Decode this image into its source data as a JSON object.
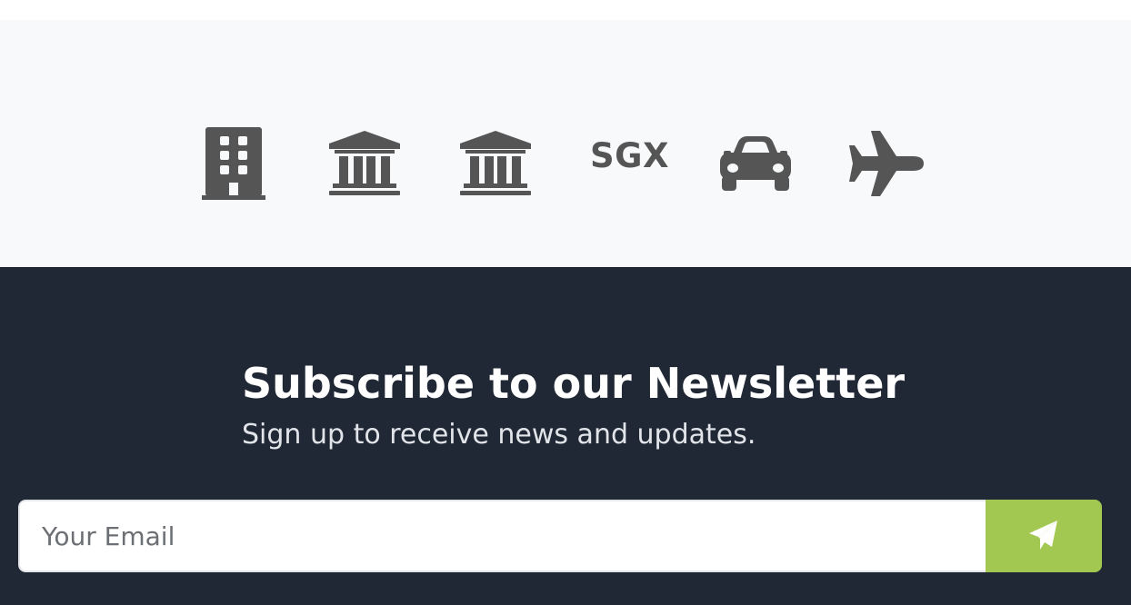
{
  "logos": {
    "icons": [
      "building-icon",
      "bank-icon",
      "bank-icon",
      "car-icon",
      "plane-icon"
    ],
    "sgx_text": "SGX",
    "icon_color": "#555555"
  },
  "newsletter": {
    "title": "Subscribe to our Newsletter",
    "subtitle": "Sign up to receive news and updates.",
    "email_placeholder": "Your Email",
    "send_icon": "paper-plane-icon",
    "background_color": "#212835",
    "button_color": "#a3c851"
  }
}
